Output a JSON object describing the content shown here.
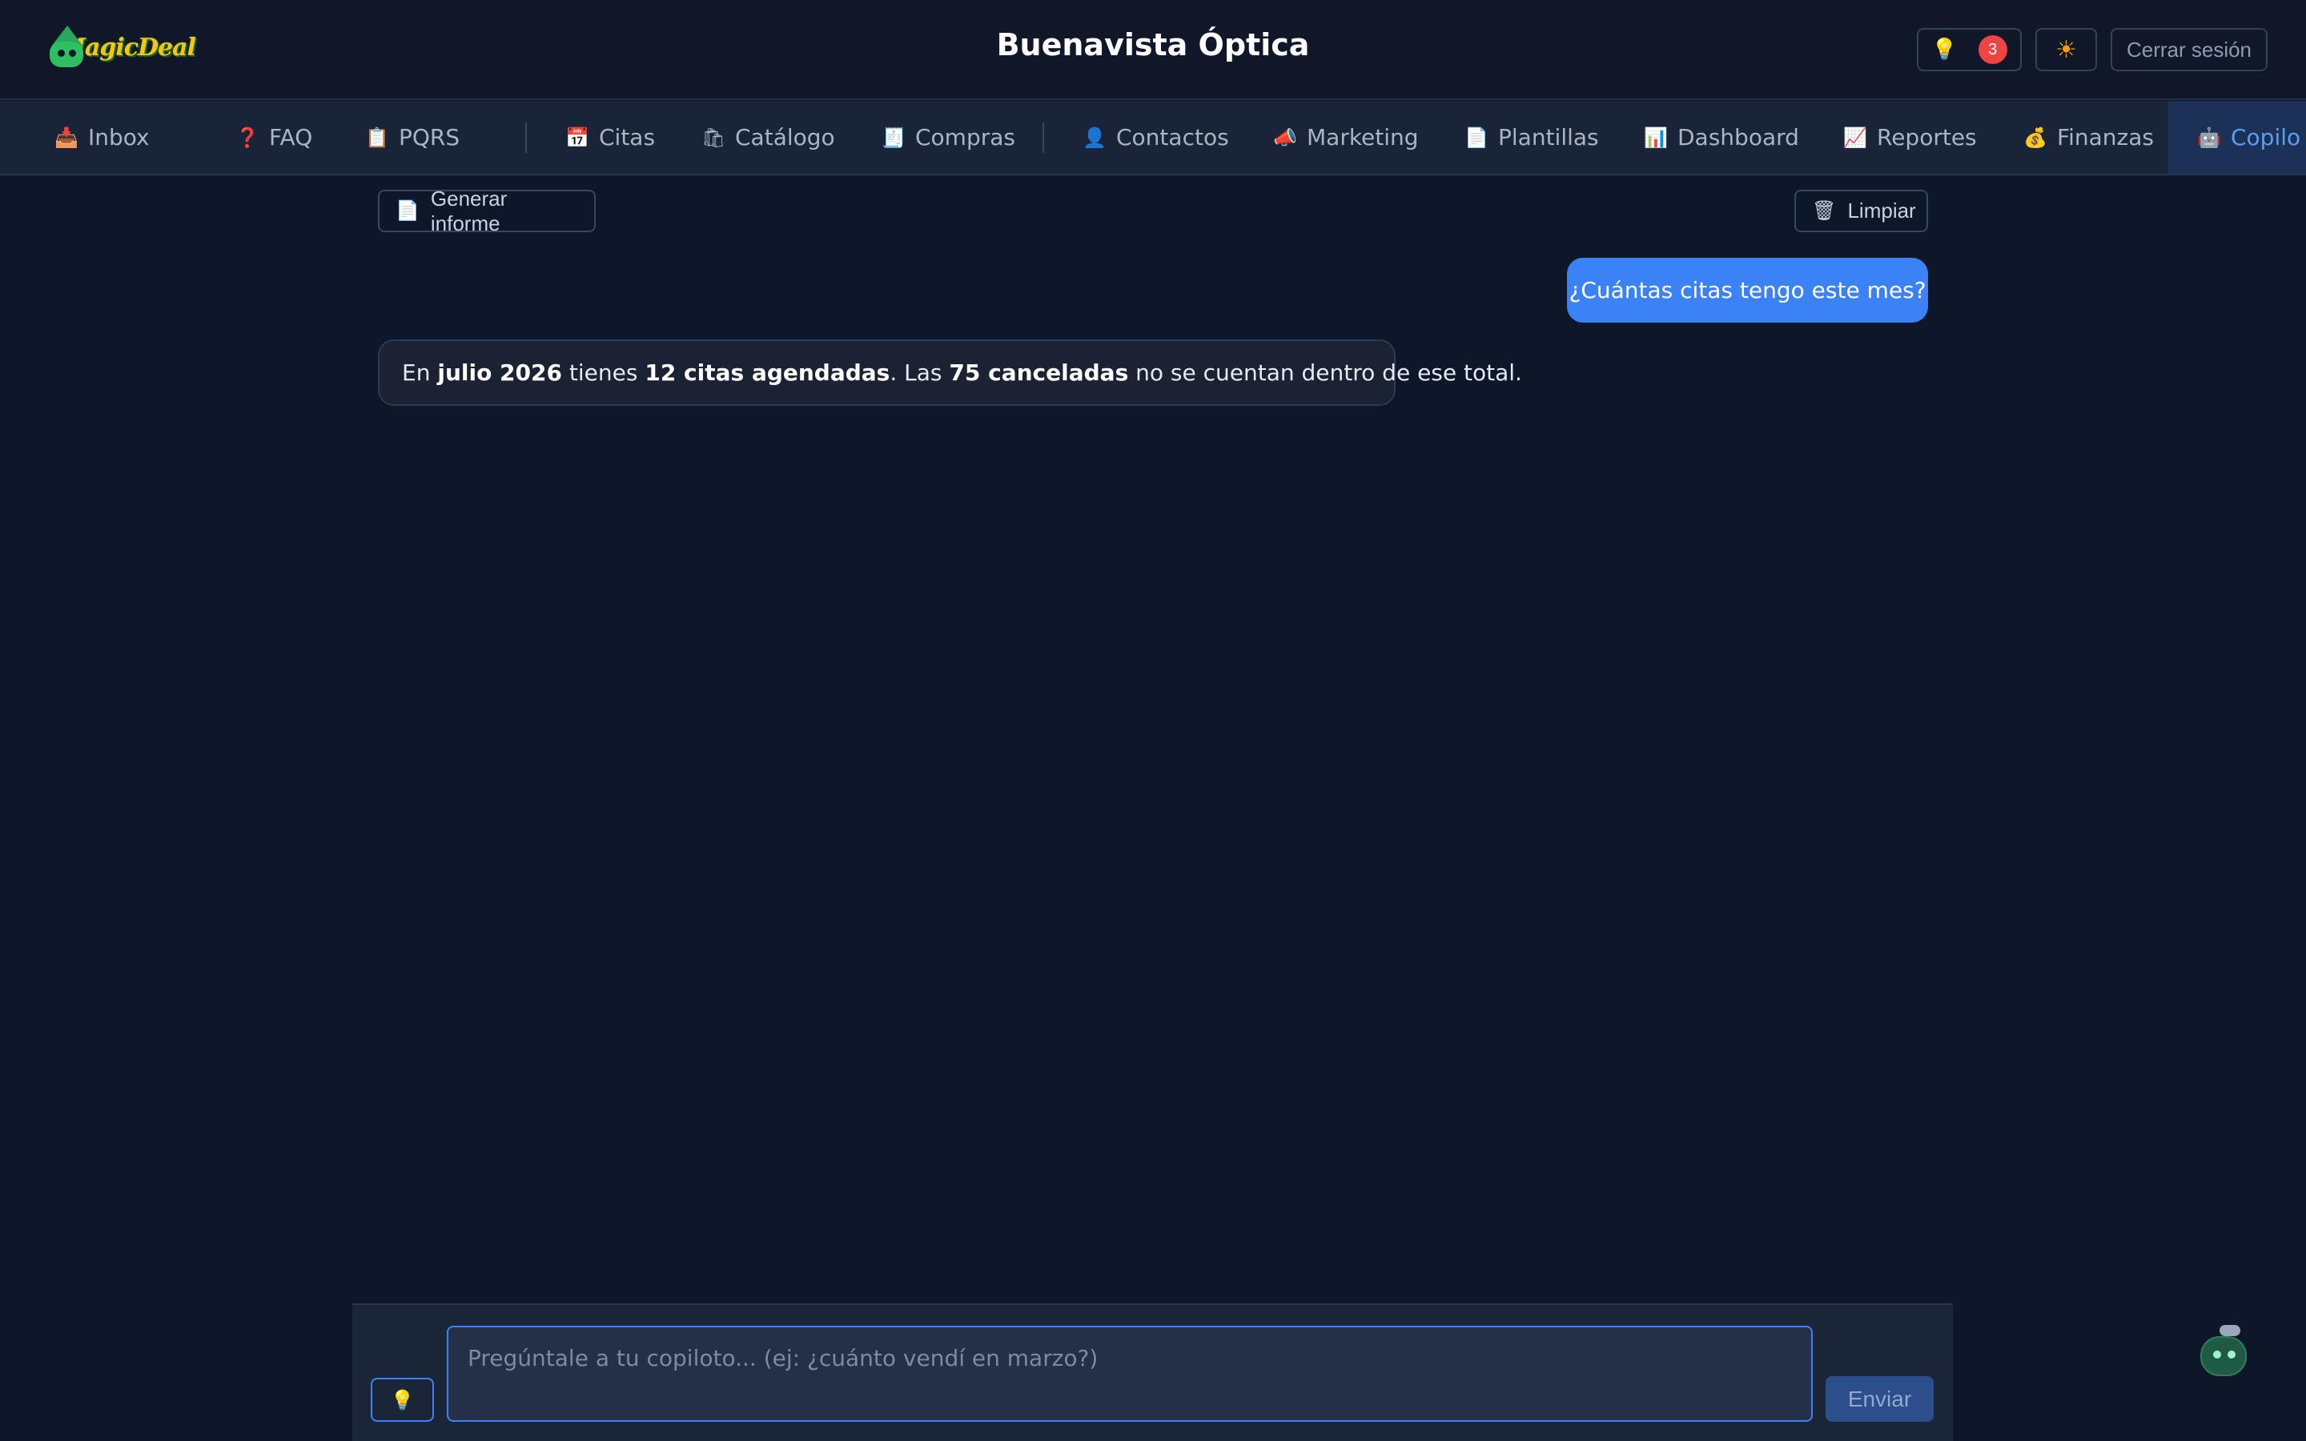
{
  "header": {
    "logo_text": "MagicDeal",
    "title": "Buenavista Óptica",
    "notifications_count": "3",
    "logout_label": "Cerrar sesión"
  },
  "nav": {
    "items": [
      {
        "label": "Inbox",
        "icon": "inbox-tray-icon"
      },
      {
        "label": "FAQ",
        "icon": "question-icon"
      },
      {
        "label": "PQRS",
        "icon": "clipboard-icon"
      },
      {
        "label": "Citas",
        "icon": "calendar-icon"
      },
      {
        "label": "Catálogo",
        "icon": "shopping-bags-icon"
      },
      {
        "label": "Compras",
        "icon": "receipt-icon"
      },
      {
        "label": "Contactos",
        "icon": "person-icon"
      },
      {
        "label": "Marketing",
        "icon": "megaphone-icon"
      },
      {
        "label": "Plantillas",
        "icon": "document-icon"
      },
      {
        "label": "Dashboard",
        "icon": "bar-chart-icon"
      },
      {
        "label": "Reportes",
        "icon": "line-chart-icon"
      },
      {
        "label": "Finanzas",
        "icon": "money-bag-icon"
      },
      {
        "label": "Copilo",
        "icon": "robot-icon",
        "active": true
      }
    ]
  },
  "toolbar": {
    "generate_report_label": "Generar informe",
    "clear_label": "Limpiar"
  },
  "chat": {
    "user_message": "¿Cuántas citas tengo este mes?",
    "bot_message": {
      "p1": "En ",
      "b1": "julio 2026",
      "p2": " tienes ",
      "b2": "12 citas agendadas",
      "p3": ". Las ",
      "b3": "75 canceladas",
      "p4": " no se cuentan dentro de ese total."
    }
  },
  "input": {
    "placeholder": "Pregúntale a tu copiloto... (ej: ¿cuánto vendí en marzo?)",
    "value": "",
    "send_label": "Enviar"
  },
  "colors": {
    "background": "#0e1629",
    "accent": "#3b82f6",
    "badge": "#ef4444"
  }
}
